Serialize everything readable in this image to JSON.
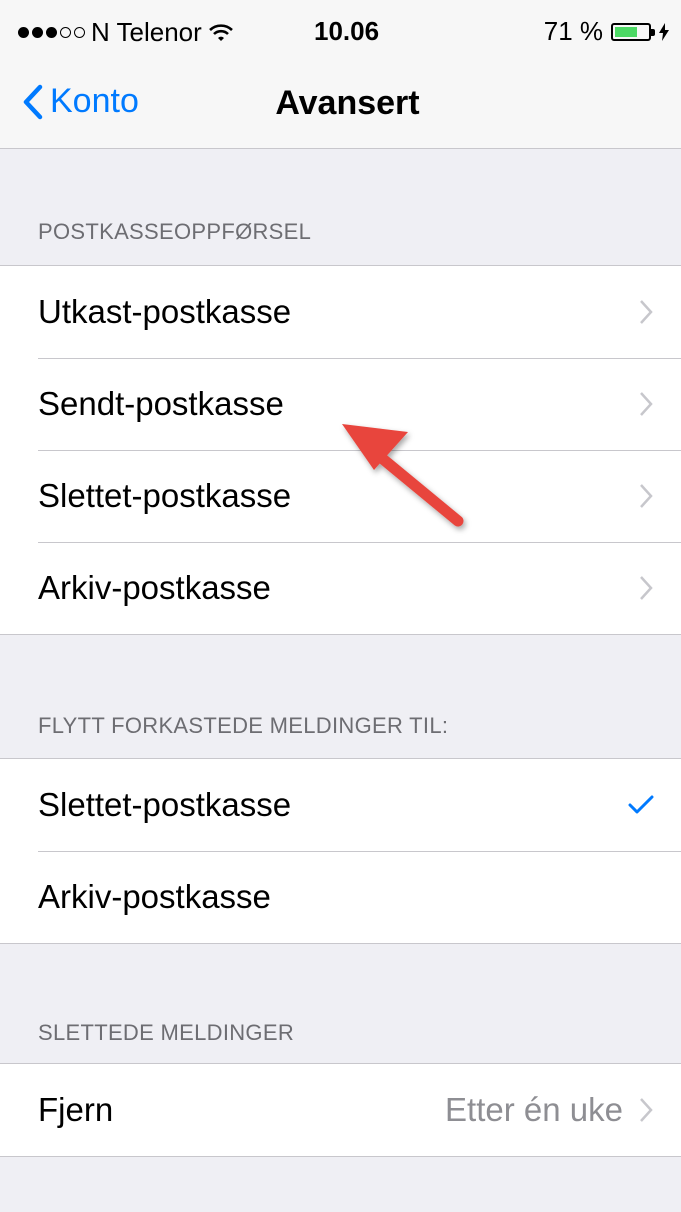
{
  "status_bar": {
    "carrier": "N Telenor",
    "time": "10.06",
    "battery_percent": "71 %",
    "battery_level": 0.71,
    "signal_bars_filled": 3,
    "signal_bars_total": 5
  },
  "nav": {
    "back_label": "Konto",
    "title": "Avansert"
  },
  "sections": [
    {
      "header": "POSTKASSEOPPFØRSEL",
      "rows": [
        {
          "label": "Utkast-postkasse"
        },
        {
          "label": "Sendt-postkasse"
        },
        {
          "label": "Slettet-postkasse"
        },
        {
          "label": "Arkiv-postkasse"
        }
      ]
    },
    {
      "header": "FLYTT FORKASTEDE MELDINGER TIL:",
      "rows": [
        {
          "label": "Slettet-postkasse",
          "checked": true
        },
        {
          "label": "Arkiv-postkasse",
          "checked": false
        }
      ]
    },
    {
      "header": "SLETTEDE MELDINGER",
      "rows": [
        {
          "label": "Fjern",
          "detail": "Etter én uke"
        }
      ]
    }
  ],
  "colors": {
    "accent": "#007aff",
    "background": "#efeff4",
    "separator": "#c8c7cc",
    "header_text": "#6d6d72",
    "annotation_arrow": "#e8453c"
  },
  "icons": [
    "back-chevron-icon",
    "chevron-right-icon",
    "checkmark-icon",
    "wifi-icon",
    "battery-icon",
    "charging-bolt-icon"
  ]
}
